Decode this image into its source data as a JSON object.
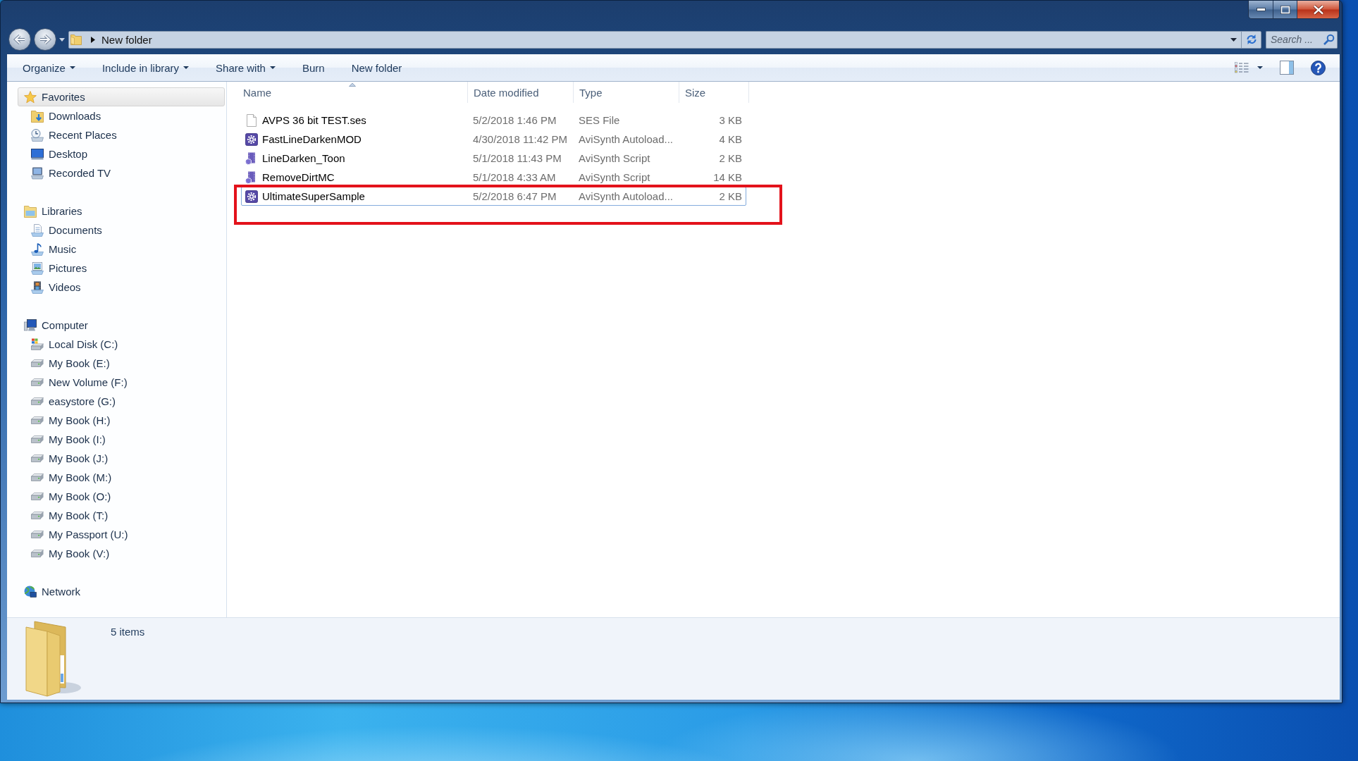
{
  "address_bar": {
    "path": [
      "New folder"
    ]
  },
  "search": {
    "placeholder": "Search ..."
  },
  "toolbar": {
    "buttons": [
      {
        "label": "Organize",
        "dropdown": true
      },
      {
        "label": "Include in library",
        "dropdown": true
      },
      {
        "label": "Share with",
        "dropdown": true
      },
      {
        "label": "Burn",
        "dropdown": false
      },
      {
        "label": "New folder",
        "dropdown": false
      }
    ]
  },
  "navigation": [
    {
      "label": "Favorites",
      "kind": "favorites",
      "selected": true,
      "children": [
        {
          "label": "Downloads",
          "kind": "downloads",
          "selected": false
        },
        {
          "label": "Recent Places",
          "kind": "recent",
          "selected": false
        },
        {
          "label": "Desktop",
          "kind": "desktop",
          "selected": false
        },
        {
          "label": "Recorded TV",
          "kind": "tv",
          "selected": false
        }
      ]
    },
    {
      "label": "Libraries",
      "kind": "libraries",
      "selected": false,
      "children": [
        {
          "label": "Documents",
          "kind": "documents",
          "selected": false
        },
        {
          "label": "Music",
          "kind": "music",
          "selected": false
        },
        {
          "label": "Pictures",
          "kind": "pictures",
          "selected": false
        },
        {
          "label": "Videos",
          "kind": "videos",
          "selected": false
        }
      ]
    },
    {
      "label": "Computer",
      "kind": "computer",
      "selected": false,
      "children": [
        {
          "label": "Local Disk (C:)",
          "kind": "systemdrive",
          "selected": false
        },
        {
          "label": "My Book (E:)",
          "kind": "drive",
          "selected": false
        },
        {
          "label": "New Volume (F:)",
          "kind": "drive",
          "selected": false
        },
        {
          "label": "easystore (G:)",
          "kind": "drive",
          "selected": false
        },
        {
          "label": "My Book (H:)",
          "kind": "drive",
          "selected": false
        },
        {
          "label": "My Book (I:)",
          "kind": "drive",
          "selected": false
        },
        {
          "label": "My Book (J:)",
          "kind": "drive",
          "selected": false
        },
        {
          "label": "My Book (M:)",
          "kind": "drive",
          "selected": false
        },
        {
          "label": "My Book (O:)",
          "kind": "drive",
          "selected": false
        },
        {
          "label": "My Book (T:)",
          "kind": "drive",
          "selected": false
        },
        {
          "label": "My Passport (U:)",
          "kind": "drive",
          "selected": false
        },
        {
          "label": "My Book (V:)",
          "kind": "drive",
          "selected": false
        }
      ]
    },
    {
      "label": "Network",
      "kind": "network",
      "selected": false
    }
  ],
  "file_list": {
    "columns": [
      {
        "label": "Name",
        "sorted": true
      },
      {
        "label": "Date modified",
        "sorted": false
      },
      {
        "label": "Type",
        "sorted": false
      },
      {
        "label": "Size",
        "sorted": false
      }
    ],
    "rows": [
      {
        "kind": "blank",
        "name": "AVPS 36 bit TEST.ses",
        "date_modified": "5/2/2018 1:46 PM",
        "type": "SES File",
        "size": "3 KB",
        "focused": false,
        "annotated": false
      },
      {
        "kind": "plugin",
        "name": "FastLineDarkenMOD",
        "date_modified": "4/30/2018 11:42 PM",
        "type": "AviSynth Autoload...",
        "size": "4 KB",
        "focused": false,
        "annotated": false
      },
      {
        "kind": "script",
        "name": "LineDarken_Toon",
        "date_modified": "5/1/2018 11:43 PM",
        "type": "AviSynth Script",
        "size": "2 KB",
        "focused": false,
        "annotated": false
      },
      {
        "kind": "script",
        "name": "RemoveDirtMC",
        "date_modified": "5/1/2018 4:33 AM",
        "type": "AviSynth Script",
        "size": "14 KB",
        "focused": false,
        "annotated": false
      },
      {
        "kind": "plugin",
        "name": "UltimateSuperSample",
        "date_modified": "5/2/2018 6:47 PM",
        "type": "AviSynth Autoload...",
        "size": "2 KB",
        "focused": true,
        "annotated": true
      }
    ]
  },
  "details_pane": {
    "summary": "5 items"
  }
}
